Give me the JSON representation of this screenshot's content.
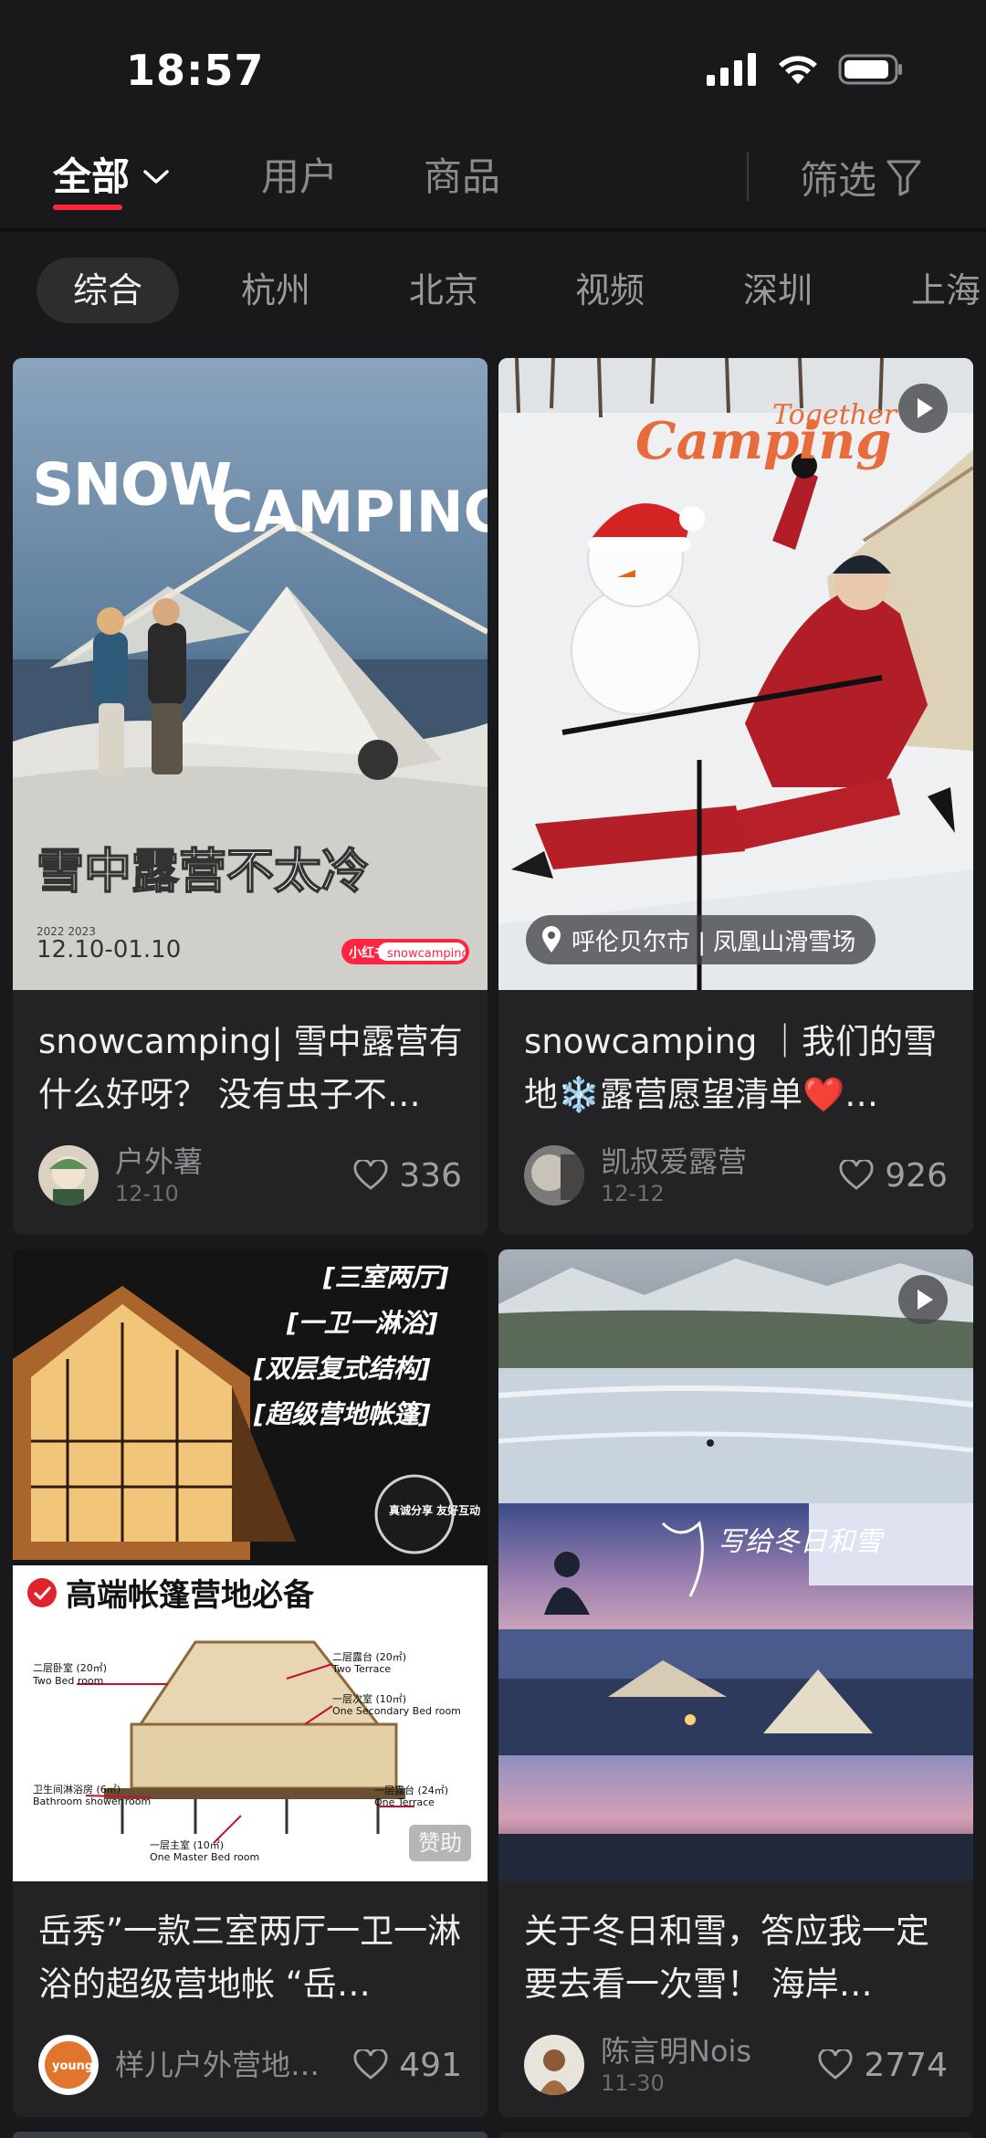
{
  "status": {
    "time": "18:57"
  },
  "top_tabs": {
    "all": "全部",
    "users": "用户",
    "goods": "商品",
    "filter": "筛选"
  },
  "chips": [
    "综合",
    "杭州",
    "北京",
    "视频",
    "深圳",
    "上海"
  ],
  "cards": [
    {
      "cover_text": {
        "headline": "SNOW CAMPING",
        "tagline": "雪中露营不太冷",
        "dates_small": "2022   2023",
        "dates": "12.10-01.10",
        "brand_tag": "小红书",
        "brand_tag2": "snowcamping"
      },
      "title": "snowcamping| 雪中露营有什么好呀？ 没有虫子不…",
      "author": "户外薯",
      "date": "12-10",
      "likes": "336"
    },
    {
      "cover_text": {
        "logo": "Camping",
        "logo_sub": "Together",
        "location": "呼伦贝尔市 | 凤凰山滑雪场"
      },
      "title": "snowcamping ｜我们的雪地❄️露营愿望清单❤️…",
      "author": "凯叔爱露营",
      "date": "12-12",
      "likes": "926"
    },
    {
      "cover_text": {
        "lines": [
          "[三室两厅]",
          "[一卫一淋浴]",
          "[双层复式结构]",
          "[超级营地帐篷]"
        ],
        "badge": "真诚分享 友好互动",
        "headline": "高端帐篷营地必备",
        "label_2f_bed": "二层卧室 (20㎡)",
        "label_2f_bed_en": "Two Bed room",
        "label_2f_terrace": "二层露台 (20㎡)",
        "label_2f_terrace_en": "Two Terrace",
        "label_1f_second": "一层次室 (10㎡)",
        "label_1f_second_en": "One Secondary Bed room",
        "label_bath": "卫生间淋浴房 (6㎡)",
        "label_bath_en": "Bathroom shower room",
        "label_1f_terrace": "一层露台 (24㎡)",
        "label_1f_terrace_en": "One Terrace",
        "label_master": "一层主室 (10㎡)",
        "label_master_en": "One Master Bed room",
        "ad": "赞助"
      },
      "title": "岳秀”一款三室两厅一卫一淋浴的超级营地帐 “岳…",
      "author": "样儿户外营地…",
      "date": "",
      "likes": "491"
    },
    {
      "cover_text": {
        "script": "写给冬日和雪"
      },
      "title": "关于冬日和雪，答应我一定要去看一次雪！ 海岸…",
      "author": "陈言明Nois",
      "date": "11-30",
      "likes": "2774"
    }
  ],
  "colors": {
    "accent": "#ff2442",
    "background": "#19191b",
    "card": "#232326"
  }
}
